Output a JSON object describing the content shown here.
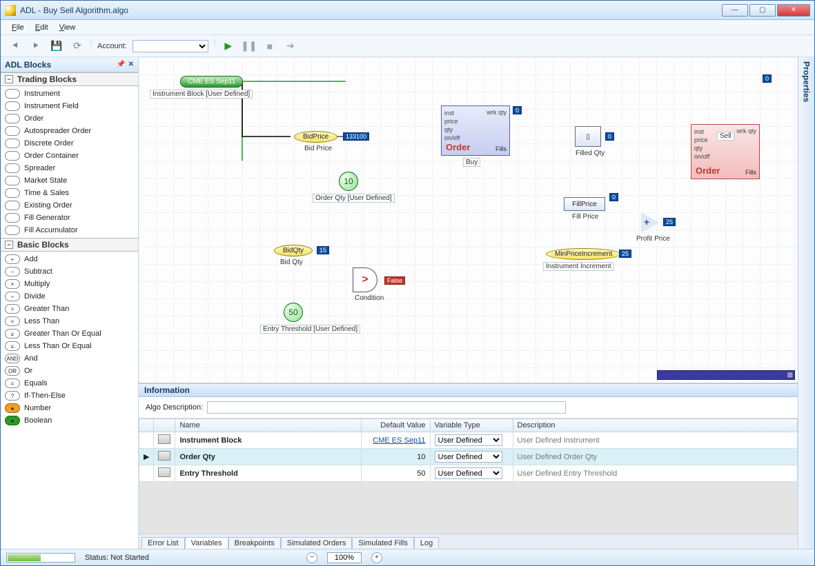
{
  "window": {
    "title": "ADL - Buy Sell Algorithm.algo"
  },
  "menu": {
    "file": "File",
    "edit": "Edit",
    "view": "View"
  },
  "toolbar": {
    "account_label": "Account:"
  },
  "panels": {
    "blocks_title": "ADL Blocks",
    "trading_header": "Trading Blocks",
    "basic_header": "Basic Blocks",
    "properties_title": "Properties"
  },
  "trading_items": [
    {
      "label": "Instrument"
    },
    {
      "label": "Instrument Field"
    },
    {
      "label": "Order"
    },
    {
      "label": "Autospreader Order"
    },
    {
      "label": "Discrete Order"
    },
    {
      "label": "Order Container"
    },
    {
      "label": "Spreader"
    },
    {
      "label": "Market State"
    },
    {
      "label": "Time & Sales"
    },
    {
      "label": "Existing Order"
    },
    {
      "label": "Fill Generator"
    },
    {
      "label": "Fill Accumulator"
    }
  ],
  "basic_items": [
    {
      "glyph": "+",
      "label": "Add"
    },
    {
      "glyph": "−",
      "label": "Subtract"
    },
    {
      "glyph": "×",
      "label": "Multiply"
    },
    {
      "glyph": "÷",
      "label": "Divide"
    },
    {
      "glyph": ">",
      "label": "Greater Than"
    },
    {
      "glyph": "<",
      "label": "Less Than"
    },
    {
      "glyph": "≥",
      "label": "Greater Than Or Equal"
    },
    {
      "glyph": "≤",
      "label": "Less Than Or Equal"
    },
    {
      "glyph": "AND",
      "label": "And"
    },
    {
      "glyph": "OR",
      "label": "Or"
    },
    {
      "glyph": "=",
      "label": "Equals"
    },
    {
      "glyph": "?",
      "label": "If-Then-Else"
    },
    {
      "glyph": "●",
      "label": "Number"
    },
    {
      "glyph": "●",
      "label": "Boolean"
    }
  ],
  "canvas": {
    "instrument": {
      "label": "CME ES Sep11",
      "caption": "Instrument Block [User Defined]"
    },
    "bidprice": {
      "label": "BidPrice",
      "caption": "Bid Price",
      "value": "133100"
    },
    "bidqty": {
      "label": "BidQty",
      "caption": "Bid Qty",
      "value": "15"
    },
    "orderqty": {
      "value": "10",
      "caption": "Order Qty [User Defined]"
    },
    "entrythr": {
      "value": "50",
      "caption": "Entry Threshold [User Defined]"
    },
    "condition": {
      "result": "False",
      "caption": "Condition",
      "glyph": ">"
    },
    "orderbuy": {
      "title": "Order",
      "side": "Buy",
      "ports": "inst\nprice\nqty\non/off",
      "right": "wrk qty",
      "rightval": "0",
      "fills": "Fills"
    },
    "ordersell": {
      "title": "Order",
      "side": "Sell",
      "ports": "inst\nprice\nqty\non/off",
      "right": "wrk qty",
      "rightval": "0",
      "fills": "Fills"
    },
    "filledqty": {
      "label": "Filled Qty",
      "value": "0"
    },
    "fillprice": {
      "label": "FillPrice",
      "caption": "Fill Price",
      "value": "0"
    },
    "minprice": {
      "label": "MinPriceIncrement",
      "caption": "Instrument Increment",
      "value": "25"
    },
    "profit": {
      "caption": "Profit Price",
      "value": "25"
    }
  },
  "info": {
    "header": "Information",
    "algo_desc_label": "Algo Description:",
    "cols": {
      "name": "Name",
      "default": "Default Value",
      "vtype": "Variable Type",
      "desc": "Description"
    },
    "rows": [
      {
        "name": "Instrument Block",
        "default": "CME ES Sep11",
        "vtype": "User Defined",
        "desc": "User Defined Instrument",
        "link": true
      },
      {
        "name": "Order Qty",
        "default": "10",
        "vtype": "User Defined",
        "desc": "User Defined Order Qty",
        "sel": true
      },
      {
        "name": "Entry Threshold",
        "default": "50",
        "vtype": "User Defined",
        "desc": "User Defined Entry Threshold"
      }
    ],
    "tabs": [
      "Error List",
      "Variables",
      "Breakpoints",
      "Simulated Orders",
      "Simulated Fills",
      "Log"
    ],
    "active_tab": 1
  },
  "status": {
    "text": "Status: Not Started",
    "zoom": "100%"
  }
}
